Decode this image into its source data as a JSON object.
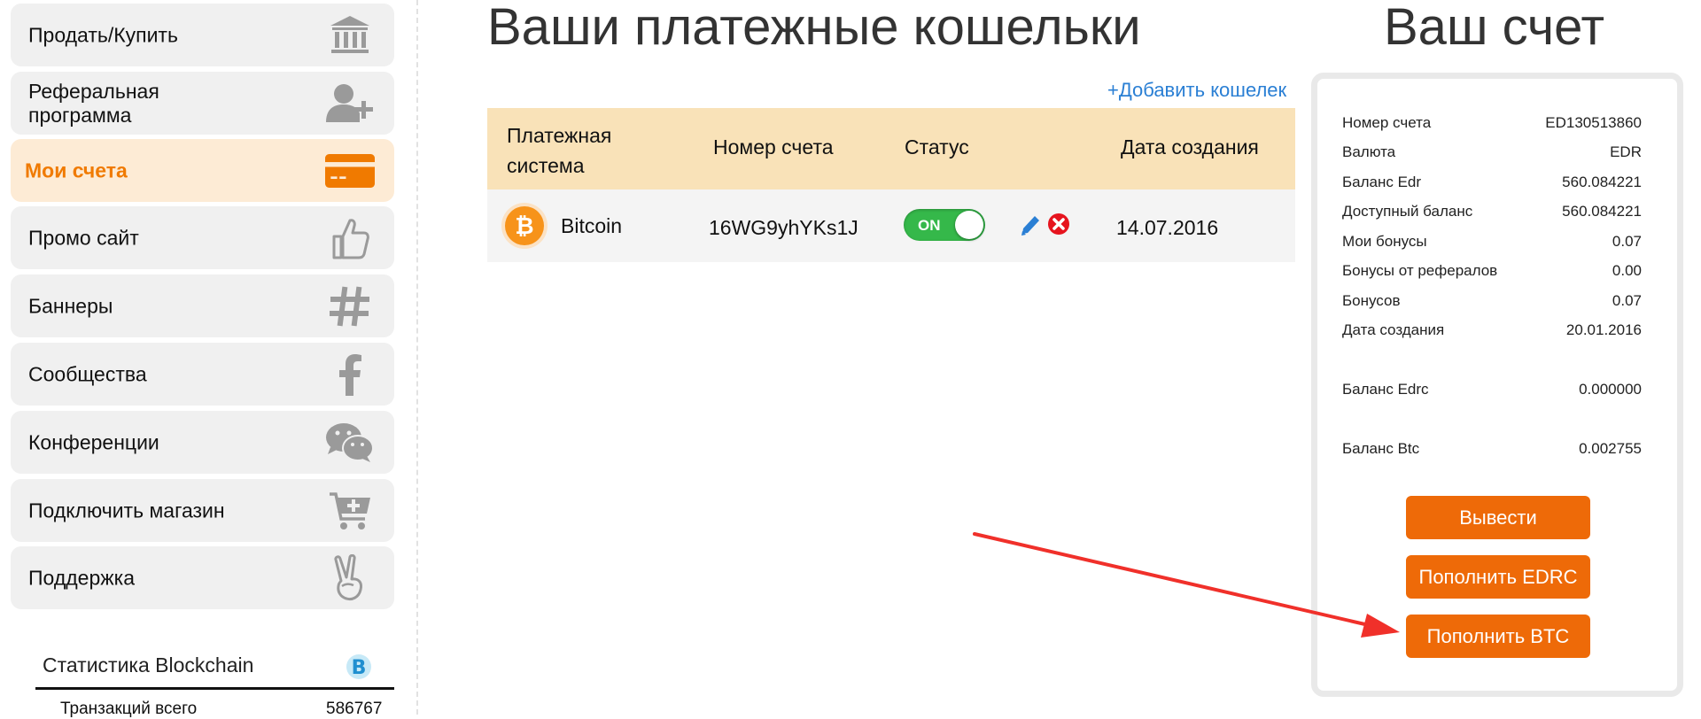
{
  "sidebar": {
    "items": [
      {
        "label": "Продать/Купить",
        "icon": "bank-icon"
      },
      {
        "label": "Реферальная\nпрограмма",
        "icon": "add-user-icon"
      },
      {
        "label": "Мои счета",
        "icon": "credit-card-icon",
        "active": true
      },
      {
        "label": "Промо сайт",
        "icon": "thumbs-up-icon"
      },
      {
        "label": "Баннеры",
        "icon": "hashtag-icon"
      },
      {
        "label": "Сообщества",
        "icon": "facebook-icon"
      },
      {
        "label": "Конференции",
        "icon": "wechat-icon"
      },
      {
        "label": "Подключить магазин",
        "icon": "cart-plus-icon"
      },
      {
        "label": "Поддержка",
        "icon": "peace-hand-icon"
      }
    ]
  },
  "stats": {
    "title": "Статистика Blockchain",
    "rows": [
      {
        "label": "Транзакций всего",
        "value": "586767"
      }
    ]
  },
  "main": {
    "title": "Ваши платежные кошельки",
    "add_link": "+Добавить кошелек",
    "columns": [
      "Платежная\nсистема",
      "Номер счета",
      "Статус",
      "Дата создания"
    ],
    "wallets": [
      {
        "system": "Bitcoin",
        "number": "16WG9yhYKs1J",
        "status": "ON",
        "created": "14.07.2016"
      }
    ]
  },
  "account": {
    "title": "Ваш счет",
    "rows": [
      {
        "label": "Номер счета",
        "value": "ED130513860"
      },
      {
        "label": "Валюта",
        "value": "EDR"
      },
      {
        "label": "Баланс Edr",
        "value": "560.084221"
      },
      {
        "label": "Доступный баланс",
        "value": "560.084221"
      },
      {
        "label": "Мои бонусы",
        "value": "0.07"
      },
      {
        "label": "Бонусы от рефералов",
        "value": "0.00"
      },
      {
        "label": "Бонусов",
        "value": "0.07"
      },
      {
        "label": "Дата создания",
        "value": "20.01.2016"
      },
      {
        "label": "Баланс Edrc",
        "value": "0.000000"
      },
      {
        "label": "Баланс Btc",
        "value": "0.002755"
      }
    ],
    "buttons": {
      "withdraw": "Вывести",
      "topup_edrc": "Пополнить EDRC",
      "topup_btc": "Пополнить BTC"
    }
  },
  "colors": {
    "accent": "#ee6a08",
    "active_bg": "#fdebd5",
    "header_bg": "#f9e2b8",
    "link": "#2a7fd4",
    "toggle_on": "#35b84a",
    "arrow": "#f0302a"
  }
}
